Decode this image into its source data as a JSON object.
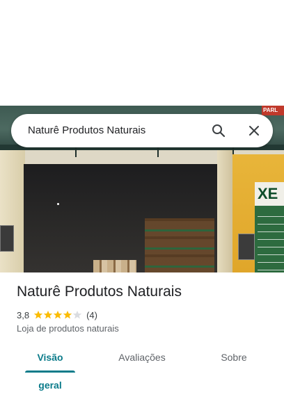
{
  "search": {
    "query": "Naturê Produtos Naturais"
  },
  "icons": {
    "search": "search-icon",
    "close": "close-icon",
    "star": "star-icon"
  },
  "place": {
    "name": "Naturê Produtos Naturais",
    "rating": "3,8",
    "rating_value": 3.8,
    "stars_filled": 4,
    "stars_total": 5,
    "review_count": "(4)",
    "category": "Loja de produtos naturais"
  },
  "photo": {
    "sign_text": "XE",
    "sign_top_text": "PARL"
  },
  "tabs": [
    {
      "label": "Visão geral",
      "active": true
    },
    {
      "label": "Avaliações",
      "active": false
    },
    {
      "label": "Sobre",
      "active": false
    }
  ],
  "colors": {
    "accent": "#0b7b8a",
    "star_filled": "#fbbc04",
    "star_empty": "#dadce0"
  }
}
